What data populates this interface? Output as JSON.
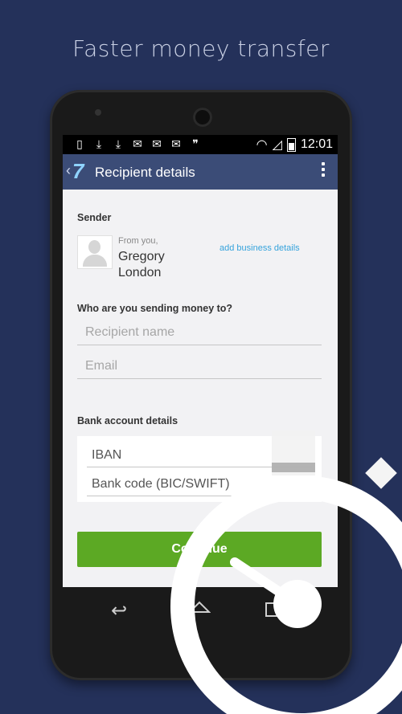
{
  "tagline": "Faster money transfer",
  "status_bar": {
    "time": "12:01",
    "icons": [
      "notification-icon",
      "download-icon",
      "download-icon",
      "mail-icon",
      "mail-icon",
      "mail-icon",
      "chat-icon",
      "wifi-icon",
      "signal-icon",
      "battery-icon"
    ]
  },
  "app_bar": {
    "title": "Recipient details",
    "logo_text": "7"
  },
  "sender": {
    "section_label": "Sender",
    "from_label": "From you,",
    "first_name": "Gregory",
    "last_name": "London",
    "add_business_link": "add business details"
  },
  "recipient": {
    "section_label": "Who are you sending money to?",
    "name_placeholder": "Recipient name",
    "email_placeholder": "Email"
  },
  "bank": {
    "section_label": "Bank account details",
    "iban_placeholder": "IBAN",
    "bic_placeholder": "Bank code (BIC/SWIFT)"
  },
  "actions": {
    "continue_label": "Continue"
  },
  "colors": {
    "background": "#24315a",
    "app_bar": "#3b4c77",
    "primary_button": "#5ca924",
    "link": "#35a3dc"
  }
}
